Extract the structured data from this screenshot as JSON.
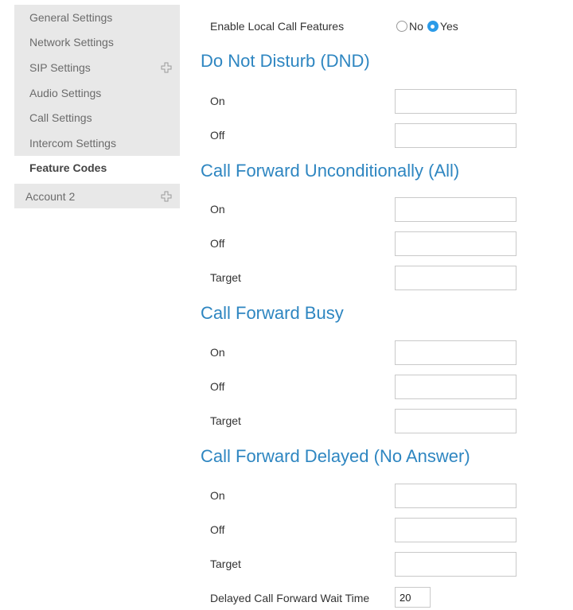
{
  "sidebar": {
    "items": [
      {
        "label": "General Settings"
      },
      {
        "label": "Network Settings"
      },
      {
        "label": "SIP Settings"
      },
      {
        "label": "Audio Settings"
      },
      {
        "label": "Call Settings"
      },
      {
        "label": "Intercom Settings"
      },
      {
        "label": "Feature Codes",
        "active": true
      }
    ],
    "account": {
      "label": "Account 2"
    }
  },
  "main": {
    "local_call_features": {
      "label": "Enable Local Call Features",
      "options": [
        "No",
        "Yes"
      ],
      "selected": "Yes"
    },
    "sections": {
      "dnd": {
        "title": "Do Not Disturb (DND)",
        "on_label": "On",
        "off_label": "Off"
      },
      "cfa": {
        "title": "Call Forward Unconditionally (All)",
        "on_label": "On",
        "off_label": "Off",
        "target_label": "Target"
      },
      "cfb": {
        "title": "Call Forward Busy",
        "on_label": "On",
        "off_label": "Off",
        "target_label": "Target"
      },
      "cfd": {
        "title": "Call Forward Delayed (No Answer)",
        "on_label": "On",
        "off_label": "Off",
        "target_label": "Target",
        "wait_label": "Delayed Call Forward Wait Time",
        "wait_value": "20"
      }
    }
  },
  "colors": {
    "accent": "#2e86c1",
    "radio_selected": "#2b9be8",
    "sidebar_bg": "#e8e8e8"
  },
  "icons": {
    "expand": "plus-icon"
  }
}
